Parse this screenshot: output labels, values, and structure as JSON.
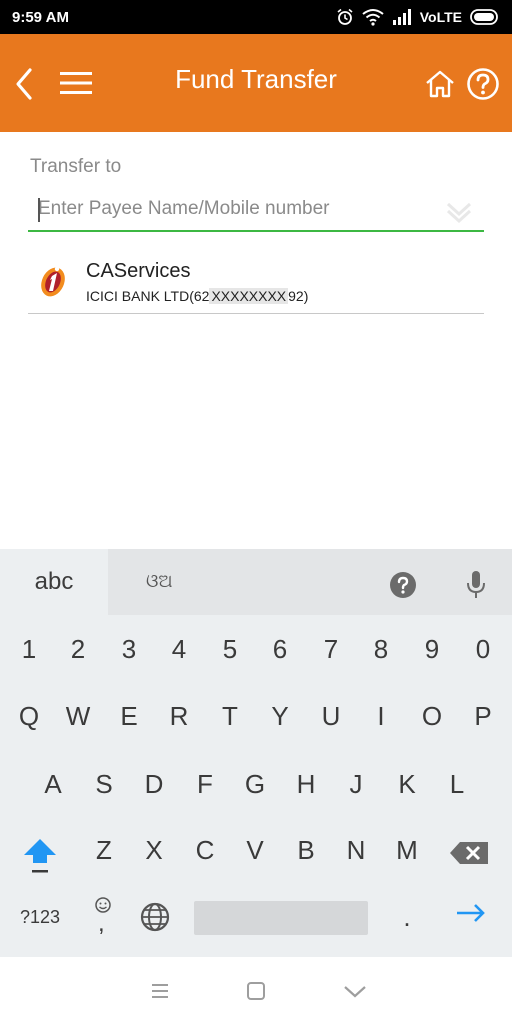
{
  "status_bar": {
    "time": "9:59 AM",
    "network": "VoLTE",
    "icons": [
      "alarm-icon",
      "wifi-icon",
      "signal-icon",
      "battery-icon"
    ]
  },
  "header": {
    "title": "Fund Transfer",
    "icons": [
      "back-icon",
      "menu-icon",
      "home-icon",
      "help-icon"
    ],
    "background_color": "#e8781e"
  },
  "transfer": {
    "label": "Transfer to",
    "input_placeholder": "Enter Payee Name/Mobile number",
    "input_value": "",
    "focus_color": "#3cb843"
  },
  "payees": [
    {
      "name": "CAServices",
      "bank": "ICICI BANK LTD(62",
      "masked": "XXXXXXXX",
      "suffix": "92)",
      "logo": "icici-logo"
    }
  ],
  "keyboard": {
    "toolbar": {
      "mode_label": "abc",
      "script_label": "ଓଅ",
      "icons": [
        "help-icon",
        "mic-icon"
      ]
    },
    "number_row": [
      "1",
      "2",
      "3",
      "4",
      "5",
      "6",
      "7",
      "8",
      "9",
      "0"
    ],
    "row1": [
      "Q",
      "W",
      "E",
      "R",
      "T",
      "Y",
      "U",
      "I",
      "O",
      "P"
    ],
    "row2": [
      "A",
      "S",
      "D",
      "F",
      "G",
      "H",
      "J",
      "K",
      "L"
    ],
    "row3": [
      "Z",
      "X",
      "C",
      "V",
      "B",
      "N",
      "M"
    ],
    "bottom": {
      "symbols_label": "?123",
      "comma": ",",
      "period": "."
    }
  },
  "nav_bar": {
    "icons": [
      "recent-apps-icon",
      "home-button-icon",
      "back-nav-icon"
    ]
  }
}
